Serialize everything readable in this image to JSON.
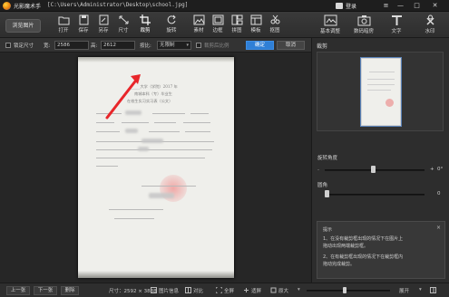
{
  "titlebar": {
    "app_name": "光影魔术手",
    "file_path": "[C:\\Users\\Administrator\\Desktop\\school.jpg]",
    "login_label": "登录",
    "minimize": "—",
    "maximize": "□",
    "close": "✕"
  },
  "toolbar": {
    "browse_label": "浏览图片",
    "tools": [
      {
        "label": "打开",
        "icon": "folder-open-icon"
      },
      {
        "label": "保存",
        "icon": "save-icon"
      },
      {
        "label": "另存",
        "icon": "save-as-icon"
      },
      {
        "label": "尺寸",
        "icon": "resize-icon"
      },
      {
        "label": "裁剪",
        "icon": "crop-icon",
        "active": true
      },
      {
        "label": "旋转",
        "icon": "rotate-icon"
      },
      {
        "label": "素材",
        "icon": "material-icon"
      },
      {
        "label": "边框",
        "icon": "border-icon"
      },
      {
        "label": "拼图",
        "icon": "collage-icon"
      },
      {
        "label": "模板",
        "icon": "template-icon"
      },
      {
        "label": "抠图",
        "icon": "cutout-icon"
      }
    ],
    "right_tools": [
      {
        "label": "基本调整",
        "icon": "adjust-icon"
      },
      {
        "label": "数码暗房",
        "icon": "camera-icon"
      },
      {
        "label": "文字",
        "icon": "text-icon"
      },
      {
        "label": "水印",
        "icon": "watermark-icon"
      }
    ]
  },
  "options": {
    "lock_ratio_label": "锁定尺寸",
    "width_label": "宽:",
    "width_value": "2586",
    "height_label": "高:",
    "height_value": "2612",
    "ratio_label": "按比:",
    "ratio_value": "无限制",
    "ratio_checkbox_label": "裁剪后比例",
    "confirm_label": "确定",
    "cancel_label": "取消"
  },
  "document": {
    "heading_line1": "_____大学（学院）2017 年",
    "heading_line2": "南城本科（专）毕业生",
    "heading_line3": "在校生实习实习表（公文）"
  },
  "bottombar": {
    "prev_label": "上一张",
    "next_label": "下一张",
    "delete_label": "删除",
    "size_text": "尺寸：2592 × 3888",
    "info_label": "图片信息",
    "compare_label": "对比",
    "fullscreen_label": "全屏",
    "fit_label": "适屏",
    "original_label": "原大",
    "share_label": "展开"
  },
  "rpanel": {
    "thumb_heading": "裁剪",
    "rotation_label": "旋转角度",
    "rotation_value": "0°",
    "round_label": "圆角",
    "round_value": "0",
    "tips_title": "提示",
    "tips_line1": "1、在没有裁剪框出现的情况下在图片上",
    "tips_line2": "拖动出现两端裁剪框。",
    "tips_line3": "2、在有裁剪框出现的情况下在裁剪框内",
    "tips_line4": "拖动完成裁剪。"
  },
  "colors": {
    "accent": "#2f7fd6",
    "arrow": "#e8262a"
  }
}
